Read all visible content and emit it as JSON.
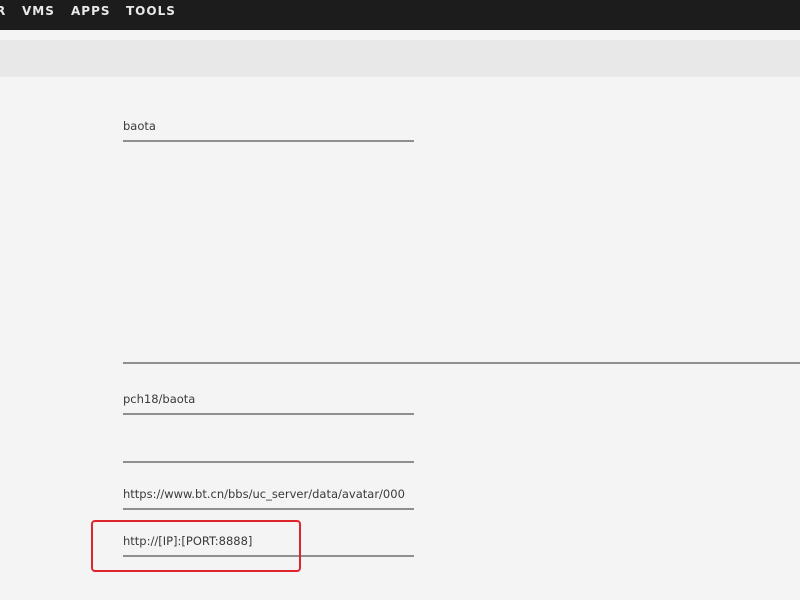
{
  "nav": {
    "items": [
      {
        "label": "R"
      },
      {
        "label": "VMS"
      },
      {
        "label": "APPS"
      },
      {
        "label": "TOOLS"
      }
    ]
  },
  "form": {
    "name_value": "baota",
    "description_value": "",
    "repository_value": "pch18/baota",
    "support_value": "",
    "icon_url_value": "https://www.bt.cn/bbs/uc_server/data/avatar/000",
    "webui_value": "http://[IP]:[PORT:8888]"
  },
  "colors": {
    "topbar": "#1c1c1c",
    "highlight": "#e0242b"
  }
}
